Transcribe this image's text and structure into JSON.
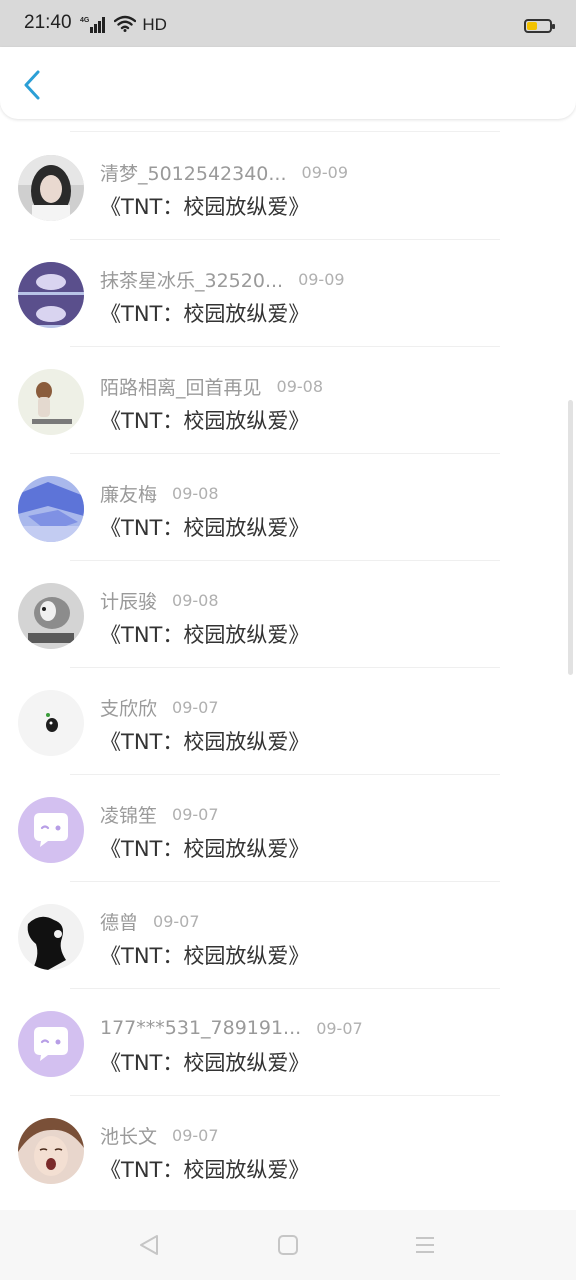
{
  "status_bar": {
    "time": "21:40",
    "network_label": "4G",
    "hd_label": "HD",
    "battery_level": 0.45,
    "battery_color": "#f2c200",
    "icons": [
      "signal-icon",
      "wifi-icon",
      "battery-icon"
    ]
  },
  "header": {
    "back_icon": "chevron-left-icon",
    "accent_color": "#2b9fd6"
  },
  "list": {
    "items": [
      {
        "username": "清梦_5012542340...",
        "date": "09-09",
        "title": "《TNT：校园放纵爱》",
        "avatar": "photo-girl-dark-hair"
      },
      {
        "username": "抹茶星冰乐_32520...",
        "date": "09-09",
        "title": "《TNT：校园放纵爱》",
        "avatar": "photo-anime-purple"
      },
      {
        "username": "陌路相离_回首再见",
        "date": "09-08",
        "title": "《TNT：校园放纵爱》",
        "avatar": "photo-girl-text"
      },
      {
        "username": "廉友梅",
        "date": "09-08",
        "title": "《TNT：校园放纵爱》",
        "avatar": "photo-blue-cubes"
      },
      {
        "username": "计辰骏",
        "date": "09-08",
        "title": "《TNT：校园放纵爱》",
        "avatar": "photo-dog-grayscale"
      },
      {
        "username": "支欣欣",
        "date": "09-07",
        "title": "《TNT：校园放纵爱》",
        "avatar": "photo-small-figure"
      },
      {
        "username": "凌锦笙",
        "date": "09-07",
        "title": "《TNT：校园放纵爱》",
        "avatar": "default-chat-avatar"
      },
      {
        "username": "德曾",
        "date": "09-07",
        "title": "《TNT：校园放纵爱》",
        "avatar": "photo-bw-silhouette"
      },
      {
        "username": "177***531_789191...",
        "date": "09-07",
        "title": "《TNT：校园放纵爱》",
        "avatar": "default-chat-avatar"
      },
      {
        "username": "池长文",
        "date": "09-07",
        "title": "《TNT：校园放纵爱》",
        "avatar": "photo-girl-face"
      }
    ]
  },
  "nav_bar": {
    "buttons": [
      "back-triangle-icon",
      "home-square-icon",
      "menu-lines-icon"
    ]
  },
  "colors": {
    "username": "#9a9a9a",
    "date": "#b0b0b0",
    "title": "#333333",
    "default_avatar": "#d3c0f0"
  }
}
